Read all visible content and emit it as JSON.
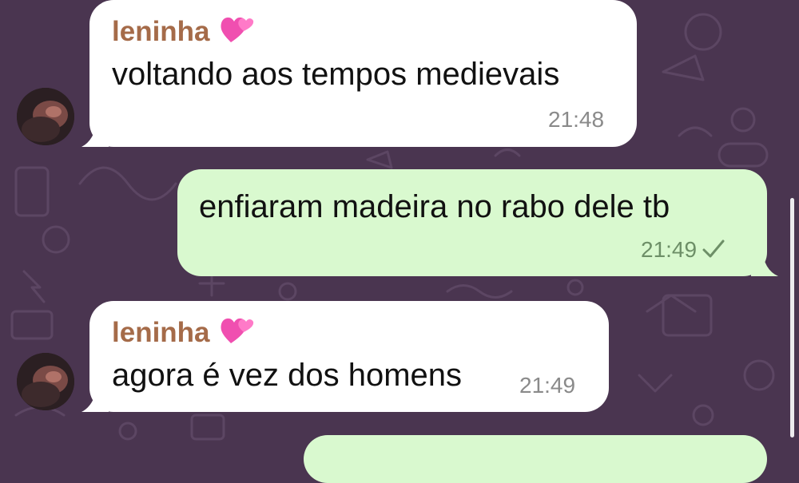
{
  "chat": {
    "messages": [
      {
        "direction": "incoming",
        "sender": "leninha",
        "text": "voltando aos tempos medievais",
        "time": "21:48"
      },
      {
        "direction": "outgoing",
        "text": "enfiaram madeira no rabo dele tb",
        "time": "21:49",
        "status": "sent-check-icon"
      },
      {
        "direction": "incoming",
        "sender": "leninha",
        "text": "agora é vez dos homens",
        "time": "21:49"
      }
    ]
  },
  "colors": {
    "wallpaper": "#4a3550",
    "incoming_bubble": "#ffffff",
    "outgoing_bubble": "#d9f9cf",
    "sender_name": "#a56b49",
    "heart": "#f04fb0"
  }
}
